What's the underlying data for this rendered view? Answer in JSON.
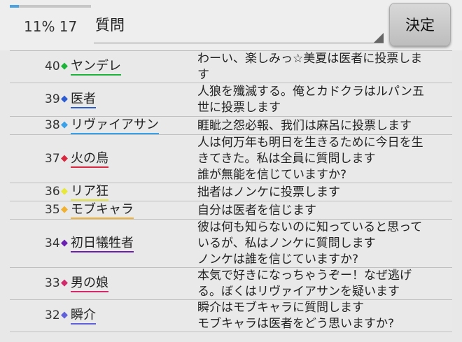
{
  "header": {
    "progress_percent": 11,
    "progress_text": "11% 17",
    "select_value": "質問",
    "decide_label": "決定"
  },
  "rows": [
    {
      "num": "40",
      "name": "ヤンデレ",
      "color": "#1db33a",
      "msg": "わーい、楽しみっ☆美夏は医者に投票しま\nす"
    },
    {
      "num": "39",
      "name": "医者",
      "color": "#2d5bd0",
      "msg": "人狼を殲滅する。俺とカドクラはルパン五\n世に投票します"
    },
    {
      "num": "38",
      "name": "リヴァイアサン",
      "color": "#3aa0e8",
      "msg": "睚眦之怨必報、我们は麻呂に投票します"
    },
    {
      "num": "37",
      "name": "火の鳥",
      "color": "#d8283f",
      "msg": "人は何万年も明日を生きるために今日を生\nきてきた。私は全員に質問します\n誰が無能を信じていますか?"
    },
    {
      "num": "36",
      "name": "リア狂",
      "color": "#e7e83a",
      "msg": "拙者はノンケに投票します"
    },
    {
      "num": "35",
      "name": "モブキャラ",
      "color": "#f0b030",
      "msg": "自分は医者を信じます"
    },
    {
      "num": "34",
      "name": "初日犠牲者",
      "color": "#6a1fb0",
      "msg": "彼は何も知らないのに知っていると思って\nいるが、私はノンケに質問します\nノンケは誰を信じていますか?"
    },
    {
      "num": "33",
      "name": "男の娘",
      "color": "#d02a6a",
      "msg": "本気で好きになっちゃうぞー！なぜ逃げ\nる。ぼくはリヴァイアサンを疑います"
    },
    {
      "num": "32",
      "name": "瞬介",
      "color": "#6060d8",
      "msg": "瞬介はモブキャラに質問します\nモブキャラは医者をどう思いますか?"
    }
  ]
}
